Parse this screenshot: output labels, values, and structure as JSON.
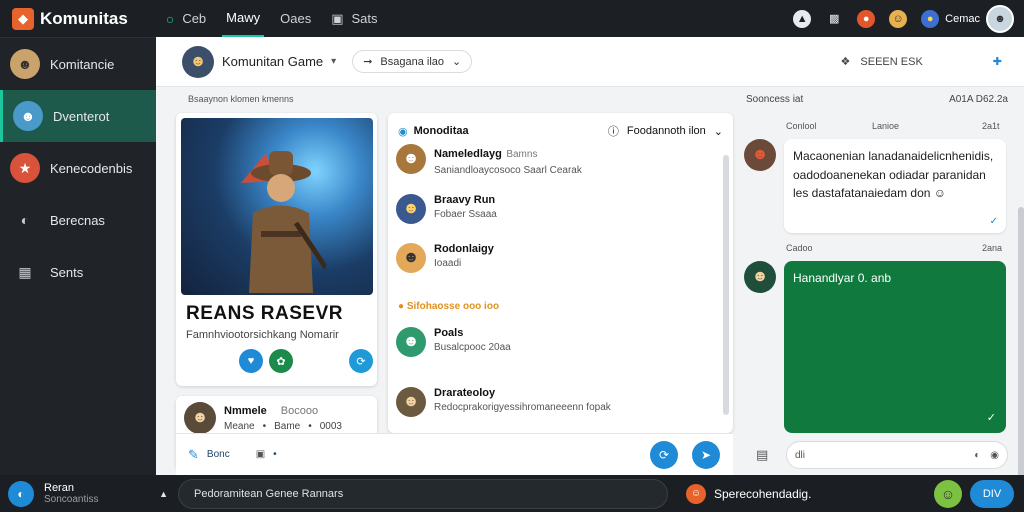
{
  "app": {
    "name": "Komunitas"
  },
  "nav": [
    {
      "label": "Ceb",
      "icon": "chat-icon"
    },
    {
      "label": "Mawy",
      "icon": "none"
    },
    {
      "label": "Oaes",
      "icon": "none"
    },
    {
      "label": "Sats",
      "icon": "bar-icon"
    }
  ],
  "topbar": {
    "user_label": "Cemac"
  },
  "sidebar": [
    {
      "label": "Komitancie"
    },
    {
      "label": "Dventerot"
    },
    {
      "label": "Kenecodenbis"
    },
    {
      "label": "Berecnas"
    },
    {
      "label": "Sents"
    }
  ],
  "chat": {
    "title": "Komunitan Game",
    "pill": "Bsagana ilao",
    "right_label": "SEEEN ESK",
    "breadcrumb": "Bsaaynon klomen kmenns"
  },
  "hero": {
    "title": "REANS RASEVR",
    "subtitle": "Famnhviootorsichkang Nomarir"
  },
  "mini": {
    "name": "Nmmele",
    "tag": "Bocooo",
    "line2a": "Meane",
    "line2b": "Bame",
    "line2c": "0003"
  },
  "list": {
    "header": "Monoditaa",
    "filter": "Foodannoth ilon",
    "section": "Sifohaosse ooo ioo",
    "items": [
      {
        "name": "Nameledlayg",
        "tag": "Bamns",
        "sub": "Saniandloaycosoco Saarl Cearak"
      },
      {
        "name": "Braavy Run",
        "sub": "Fobaer Ssaaa"
      },
      {
        "name": "Rodonlaigy",
        "sub": "Ioaadi"
      },
      {
        "name": "Poals",
        "sub": "Busalcpooc 20aa"
      },
      {
        "name": "Drarateoloy",
        "sub": "Redocprakorigyessihromaneeenn fopak"
      }
    ],
    "bottom_label": "Bonc"
  },
  "right": {
    "header_left": "Sooncess iat",
    "header_right": "A01A D62.2a",
    "m1_sender": "Conlool",
    "m1_name": "Lanioe",
    "m1_time": "2a1t",
    "m1_text": "Macaonenian lanadanaidelicnhenidis, oadodoanenekan odiadar paranidan les dastafatanaiedam don",
    "m2_sender": "Cadoo",
    "m2_time": "2ana",
    "m2_text": "Hanandlyar 0. anb",
    "composer": "dli"
  },
  "footer": {
    "user_name": "Reran",
    "user_sub": "Soncoantiss",
    "search": "Pedoramitean Genee Rannars",
    "status": "Sperecohendadig.",
    "button": "DIV"
  },
  "colors": {
    "accent": "#19c6a6",
    "brand": "#e8632c",
    "blue": "#1f8ad6",
    "green": "#107a3e",
    "orange": "#e0921c"
  }
}
